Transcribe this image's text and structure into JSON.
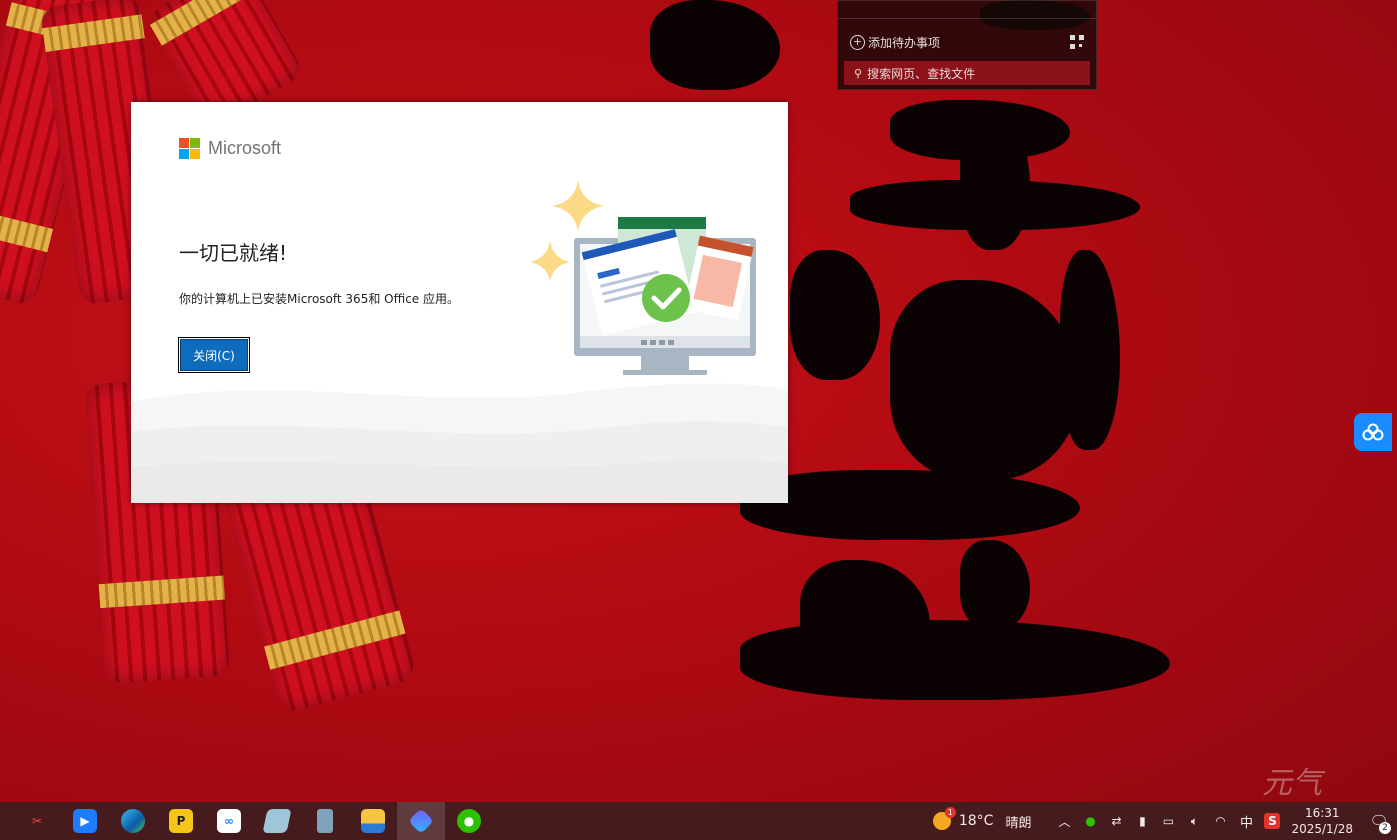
{
  "widget": {
    "add_todo": "添加待办事项",
    "search_placeholder": "搜索网页、查找文件"
  },
  "dialog": {
    "brand": "Microsoft",
    "heading": "一切已就绪!",
    "message": "你的计算机上已安装Microsoft 365和 Office 应用。",
    "close_button": "关闭(C)"
  },
  "taskbar": {
    "apps": [
      "tools",
      "feishu",
      "edge",
      "wps-pdf",
      "baidu-netdisk",
      "notes",
      "trash",
      "file-explorer",
      "copilot",
      "wechat"
    ],
    "weather": {
      "temp": "18°C",
      "desc": "晴朗",
      "badge": "1"
    },
    "ime": "中",
    "clock": {
      "time": "16:31",
      "date": "2025/1/28"
    },
    "notifications": "2"
  },
  "colors": {
    "accent": "#0f6cbd",
    "taskbar": "#461b1e",
    "wallpaper": "#b00a12"
  }
}
